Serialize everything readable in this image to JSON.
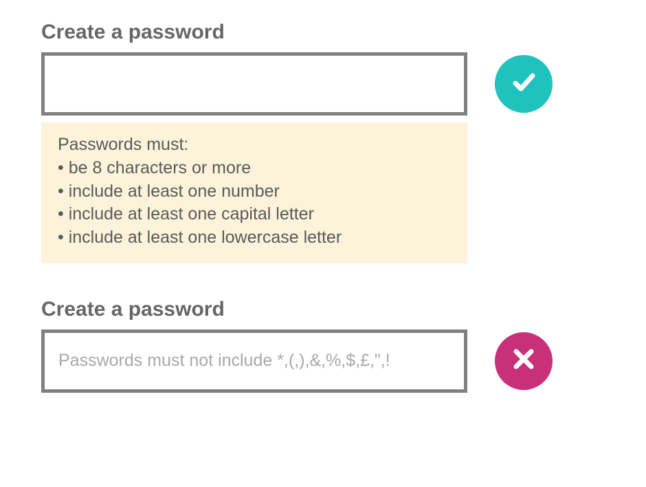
{
  "good": {
    "label": "Create a password",
    "input_value": "",
    "input_placeholder": "",
    "hint_intro": "Passwords must:",
    "hints": [
      "be 8 characters or more",
      "include at least one number",
      "include at least one capital letter",
      "include at least one lowercase letter"
    ]
  },
  "bad": {
    "label": "Create a password",
    "input_value": "",
    "input_placeholder": "Passwords must not include *,(,),&,%,$,£,\",!"
  },
  "icons": {
    "check": "check-icon",
    "cross": "cross-icon"
  }
}
